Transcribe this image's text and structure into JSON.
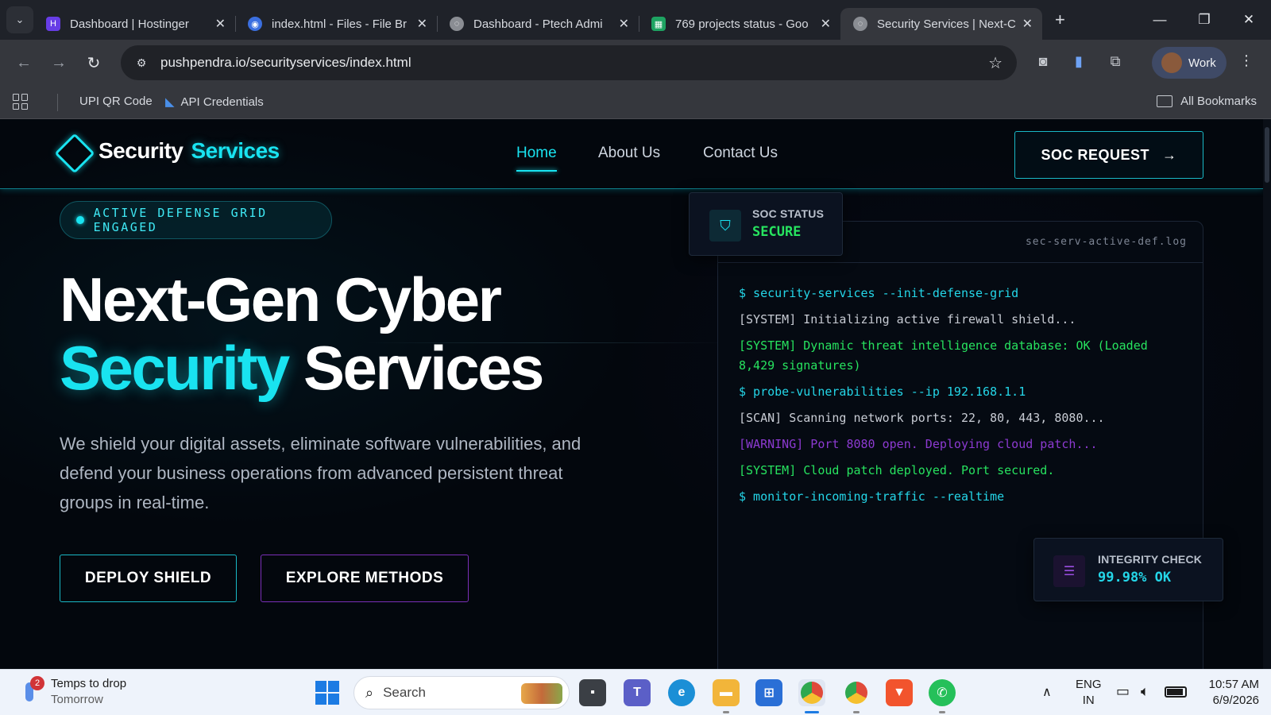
{
  "browser": {
    "tabs": [
      {
        "title": "Dashboard | Hostinger",
        "favicon": "hostinger-icon",
        "color": "#673de6",
        "active": false
      },
      {
        "title": "index.html - Files - File Br",
        "favicon": "file-browser-icon",
        "color": "#3b6fe0",
        "active": false
      },
      {
        "title": "Dashboard - Ptech Admi",
        "favicon": "globe-icon",
        "color": "#8a8d93",
        "active": false
      },
      {
        "title": "769 projects status - Goo",
        "favicon": "sheets-icon",
        "color": "#1ea362",
        "active": false
      },
      {
        "title": "Security Services | Next-C",
        "favicon": "globe-icon",
        "color": "#8a8d93",
        "active": true
      }
    ],
    "url": "pushpendra.io/securityservices/index.html",
    "profile_label": "Work",
    "bookmarks": [
      {
        "label": "UPI QR Code"
      },
      {
        "label": "API Credentials"
      }
    ],
    "all_bookmarks_label": "All Bookmarks"
  },
  "site": {
    "logo": {
      "part1": "Security",
      "part2": "Services"
    },
    "nav": [
      {
        "label": "Home",
        "active": true
      },
      {
        "label": "About Us",
        "active": false
      },
      {
        "label": "Contact Us",
        "active": false
      }
    ],
    "cta_label": "SOC REQUEST",
    "status_pill": "ACTIVE DEFENSE GRID ENGAGED",
    "hero": {
      "line1": "Next-Gen Cyber",
      "line2_highlight": "Security",
      "line2_rest": "Services"
    },
    "description": "We shield your digital assets, eliminate software vulnerabilities, and defend your business operations from advanced persistent threat groups in real-time.",
    "buttons": {
      "deploy": "DEPLOY SHIELD",
      "explore": "EXPLORE METHODS"
    },
    "terminal": {
      "filename": "sec-serv-active-def.log",
      "lines": [
        {
          "type": "cmd",
          "text": "$ security-services --init-defense-grid"
        },
        {
          "type": "sys",
          "text": "[SYSTEM] Initializing active firewall shield..."
        },
        {
          "type": "ok",
          "text": "[SYSTEM] Dynamic threat intelligence database: OK (Loaded 8,429 signatures)"
        },
        {
          "type": "cmd",
          "text": "$ probe-vulnerabilities --ip 192.168.1.1"
        },
        {
          "type": "sys",
          "text": "[SCAN] Scanning network ports: 22, 80, 443, 8080..."
        },
        {
          "type": "warn",
          "text": "[WARNING] Port 8080 open. Deploying cloud patch..."
        },
        {
          "type": "ok",
          "text": "[SYSTEM] Cloud patch deployed. Port secured."
        },
        {
          "type": "cmd",
          "text": "$ monitor-incoming-traffic --realtime"
        }
      ]
    },
    "soc_status": {
      "label": "SOC STATUS",
      "value": "SECURE"
    },
    "integrity": {
      "label": "INTEGRITY CHECK",
      "value": "99.98% OK"
    }
  },
  "taskbar": {
    "weather": {
      "title": "Temps to drop",
      "subtitle": "Tomorrow",
      "badge": "2"
    },
    "search_placeholder": "Search",
    "apps": [
      {
        "name": "file-explorer-icon",
        "color": "#9aa3ad"
      },
      {
        "name": "teams-icon",
        "color": "#5b5fc7"
      },
      {
        "name": "edge-icon",
        "color": "#1b8fd6"
      },
      {
        "name": "folder-icon",
        "color": "#f2b53a"
      },
      {
        "name": "store-icon",
        "color": "#2a6fd6"
      },
      {
        "name": "chrome-icon",
        "color": "#e04a3a"
      },
      {
        "name": "chrome-profile-icon",
        "color": "#2fa84f"
      },
      {
        "name": "brave-icon",
        "color": "#f2542d"
      },
      {
        "name": "whatsapp-icon",
        "color": "#25c05a"
      }
    ],
    "lang": {
      "line1": "ENG",
      "line2": "IN"
    },
    "time": "10:57 AM",
    "date": "6/9/2026"
  }
}
